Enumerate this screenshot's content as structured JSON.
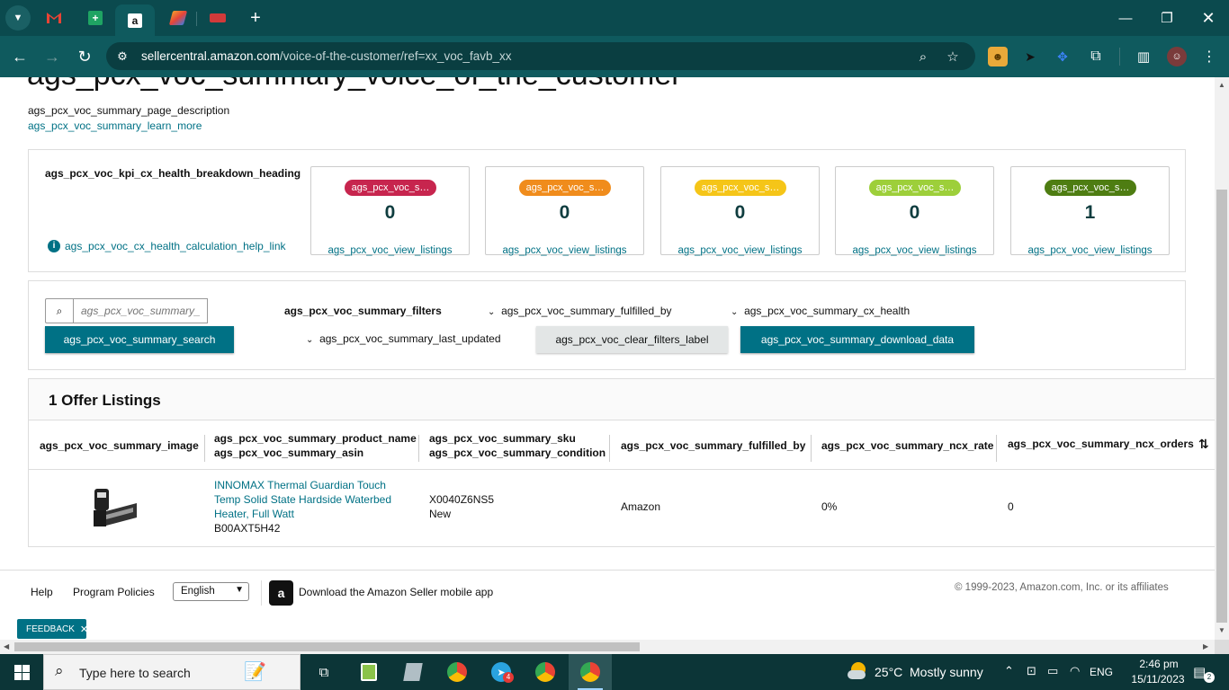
{
  "browser": {
    "url_host": "sellercentral.amazon.com",
    "url_path": "/voice-of-the-customer/ref=xx_voc_favb_xx"
  },
  "page": {
    "title": "ags_pcx_voc_summary_voice_of_the_customer",
    "description": "ags_pcx_voc_summary_page_description",
    "learn_more": "ags_pcx_voc_summary_learn_more"
  },
  "kpi": {
    "heading": "ags_pcx_voc_kpi_cx_health_breakdown_heading",
    "help_link": "ags_pcx_voc_cx_health_calculation_help_link",
    "cards": [
      {
        "badge": "ags_pcx_voc_s…",
        "color": "#c7254e",
        "value": "0",
        "link": "ags_pcx_voc_view_listings"
      },
      {
        "badge": "ags_pcx_voc_s…",
        "color": "#f08c1c",
        "value": "0",
        "link": "ags_pcx_voc_view_listings"
      },
      {
        "badge": "ags_pcx_voc_s…",
        "color": "#f5c518",
        "value": "0",
        "link": "ags_pcx_voc_view_listings"
      },
      {
        "badge": "ags_pcx_voc_s…",
        "color": "#9dcf3a",
        "value": "0",
        "link": "ags_pcx_voc_view_listings"
      },
      {
        "badge": "ags_pcx_voc_s…",
        "color": "#4e7d12",
        "value": "1",
        "link": "ags_pcx_voc_view_listings"
      }
    ]
  },
  "filters": {
    "search_placeholder": "ags_pcx_voc_summary_s",
    "search_button": "ags_pcx_voc_summary_search",
    "label": "ags_pcx_voc_summary_filters",
    "fulfilled_by": "ags_pcx_voc_summary_fulfilled_by",
    "cx_health": "ags_pcx_voc_summary_cx_health",
    "last_updated": "ags_pcx_voc_summary_last_updated",
    "clear": "ags_pcx_voc_clear_filters_label",
    "download": "ags_pcx_voc_summary_download_data"
  },
  "listings": {
    "heading": "1 Offer Listings",
    "columns": {
      "image": "ags_pcx_voc_summary_image",
      "product_name": "ags_pcx_voc_summary_product_name",
      "asin": "ags_pcx_voc_summary_asin",
      "sku": "ags_pcx_voc_summary_sku",
      "condition": "ags_pcx_voc_summary_condition",
      "fulfilled_by": "ags_pcx_voc_summary_fulfilled_by",
      "ncx_rate": "ags_pcx_voc_summary_ncx_rate",
      "ncx_orders": "ags_pcx_voc_summary_ncx_orders"
    },
    "rows": [
      {
        "product_name": "INNOMAX Thermal Guardian Touch Temp Solid State Hardside Waterbed Heater, Full Watt",
        "asin": "B00AXT5H42",
        "sku": "X0040Z6NS5",
        "condition": "New",
        "fulfilled_by": "Amazon",
        "ncx_rate": "0%",
        "ncx_orders": "0"
      }
    ]
  },
  "footer": {
    "help": "Help",
    "policies": "Program Policies",
    "language": "English",
    "app": "Download the Amazon Seller mobile app",
    "copyright": "© 1999-2023, Amazon.com, Inc. or its affiliates",
    "feedback": "FEEDBACK"
  },
  "taskbar": {
    "search_placeholder": "Type here to search",
    "weather_temp": "25°C",
    "weather_text": "Mostly sunny",
    "lang": "ENG",
    "time": "2:46 pm",
    "date": "15/11/2023",
    "notifications": "2",
    "telegram_badge": "4"
  }
}
